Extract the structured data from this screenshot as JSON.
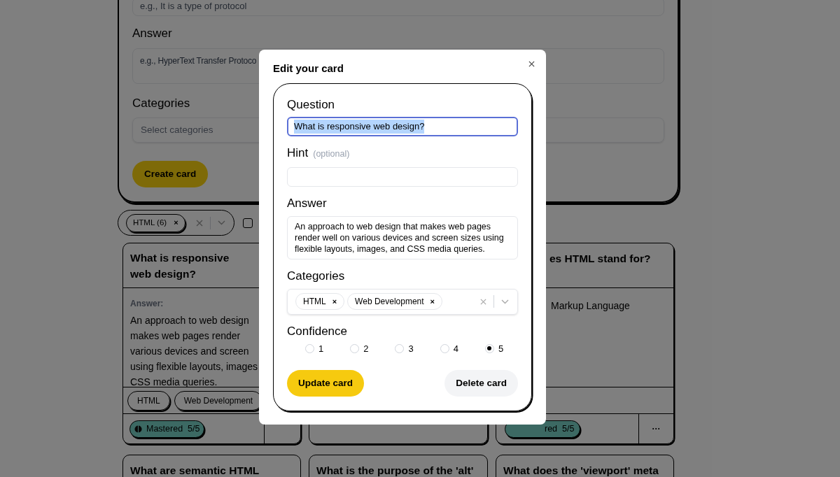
{
  "create_form": {
    "question_placeholder": "e.g., It is a type of protocol",
    "answer_label": "Answer",
    "answer_placeholder": "e.g., HyperText Transfer Protoco",
    "categories_label": "Categories",
    "categories_placeholder": "Select categories",
    "create_button": "Create card"
  },
  "filter": {
    "tags": [
      {
        "label": "HTML (6)",
        "remove": "×"
      }
    ],
    "checkbox": {
      "checked": false
    }
  },
  "cards_row_1": [
    {
      "title": "What is responsive web design?",
      "answer_label": "Answer:",
      "answer_lines": [
        "An approach to web design",
        "makes web pages render",
        "various devices and screen",
        "using flexible layouts, images",
        "CSS media queries."
      ],
      "tags": [
        "HTML",
        "Web Development"
      ],
      "status": {
        "label": "Mastered",
        "score": "5/5"
      }
    },
    {
      "title": "es HTML stand for?",
      "answer_lines": [
        "Markup Language"
      ],
      "status": {
        "label": "red",
        "score": "5/5"
      },
      "menu": "···"
    }
  ],
  "cards_row_2": [
    {
      "title": "What are semantic HTML"
    },
    {
      "title": "What is the purpose of the 'alt'"
    },
    {
      "title": "What does the 'viewport' meta"
    }
  ],
  "modal": {
    "title": "Edit your card",
    "question": {
      "label": "Question",
      "value": "What is responsive web design?",
      "text_selected": true
    },
    "hint": {
      "label": "Hint",
      "note": "(optional)"
    },
    "answer": {
      "label": "Answer",
      "value": "An approach to web design that makes web pages render well on various devices and screen sizes using flexible layouts, images, and CSS media queries."
    },
    "categories": {
      "label": "Categories",
      "tags": [
        {
          "label": "HTML",
          "remove": "×"
        },
        {
          "label": "Web Development",
          "remove": "×"
        }
      ]
    },
    "confidence": {
      "label": "Confidence",
      "options": [
        {
          "label": "1",
          "selected": false
        },
        {
          "label": "2",
          "selected": false
        },
        {
          "label": "3",
          "selected": false
        },
        {
          "label": "4",
          "selected": false
        },
        {
          "label": "5",
          "selected": true
        }
      ]
    },
    "buttons": [
      {
        "label": "Update card",
        "kind": "primary"
      },
      {
        "label": "Delete card",
        "kind": "secondary"
      }
    ]
  }
}
